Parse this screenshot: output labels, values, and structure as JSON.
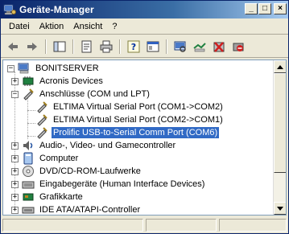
{
  "window": {
    "title": "Geräte-Manager",
    "min": "_",
    "max": "□",
    "close": "×"
  },
  "menu": [
    "Datei",
    "Aktion",
    "Ansicht",
    "?"
  ],
  "tree": {
    "root": "BONITSERVER",
    "items": [
      {
        "label": "Acronis Devices",
        "icon": "chip-icon"
      },
      {
        "label": "Anschlüsse (COM und LPT)",
        "icon": "port-icon"
      },
      {
        "label": "ELTIMA Virtual Serial Port (COM1->COM2)",
        "icon": "port-icon"
      },
      {
        "label": "ELTIMA Virtual Serial Port (COM2->COM1)",
        "icon": "port-icon"
      },
      {
        "label": "Prolific USB-to-Serial Comm Port (COM6)",
        "icon": "port-icon",
        "selected": true
      },
      {
        "label": "Audio-, Video- und Gamecontroller",
        "icon": "audio-icon"
      },
      {
        "label": "Computer",
        "icon": "computer-icon"
      },
      {
        "label": "DVD/CD-ROM-Laufwerke",
        "icon": "cdrom-icon"
      },
      {
        "label": "Eingabegeräte (Human Interface Devices)",
        "icon": "hid-icon"
      },
      {
        "label": "Grafikkarte",
        "icon": "display-icon"
      },
      {
        "label": "IDE ATA/ATAPI-Controller",
        "icon": "ide-icon"
      }
    ]
  },
  "colors": {
    "selection": "#316ac5",
    "titlebar": "#0a246a"
  }
}
